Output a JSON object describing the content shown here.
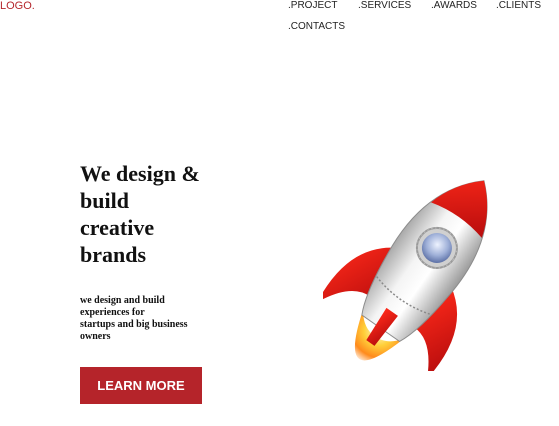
{
  "header": {
    "logo": "LOGO.",
    "nav": [
      ".PROJECT",
      ".SERVICES",
      ".AWARDS",
      ".CLIENTS",
      ".CONTACTS"
    ]
  },
  "hero": {
    "headline_lines": [
      "We design &",
      "build",
      "creative",
      "brands"
    ],
    "subtext_lines": [
      "we design and build",
      "experiences for",
      "startups and big business",
      "owners"
    ],
    "cta_label": "LEARN MORE",
    "image_icon": "rocket-icon"
  },
  "colors": {
    "accent": "#b5242a",
    "text": "#111111",
    "background": "#ffffff"
  }
}
